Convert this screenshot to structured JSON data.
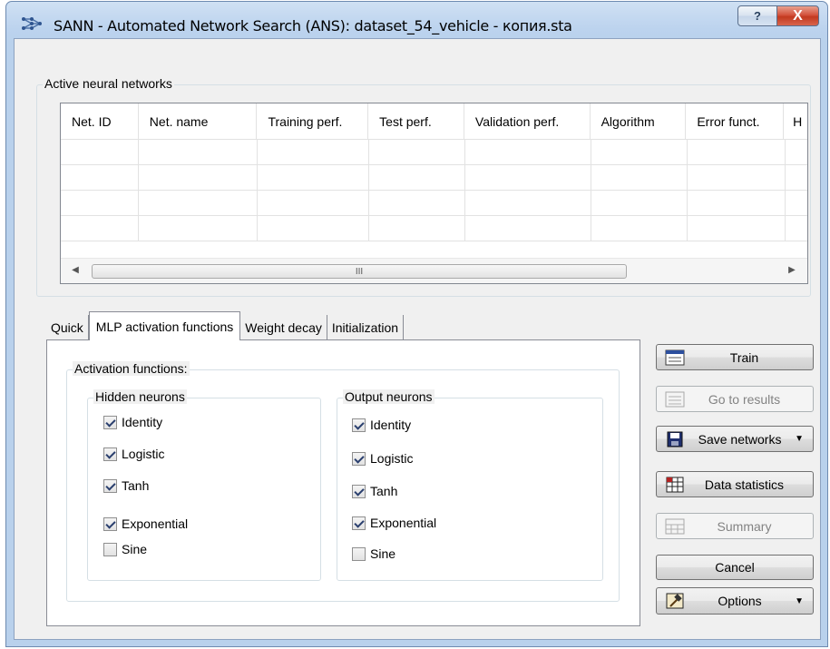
{
  "window": {
    "title": "SANN - Automated Network Search (ANS): dataset_54_vehicle - копия.sta",
    "help_label": "?",
    "close_label": "X"
  },
  "networks_group": {
    "title": "Active neural networks",
    "columns": [
      "Net. ID",
      "Net. name",
      "Training perf.",
      "Test perf.",
      "Validation perf.",
      "Algorithm",
      "Error funct.",
      "H"
    ],
    "scroll_thumb_label": "III"
  },
  "tabs": [
    {
      "label": "Quick",
      "active": false
    },
    {
      "label": "MLP activation functions",
      "active": true
    },
    {
      "label": "Weight decay",
      "active": false
    },
    {
      "label": "Initialization",
      "active": false
    }
  ],
  "activation": {
    "group_title": "Activation functions:",
    "hidden": {
      "title": "Hidden neurons",
      "items": [
        {
          "label": "Identity",
          "checked": true
        },
        {
          "label": "Logistic",
          "checked": true
        },
        {
          "label": "Tanh",
          "checked": true
        },
        {
          "label": "Exponential",
          "checked": true
        },
        {
          "label": "Sine",
          "checked": false
        }
      ]
    },
    "output": {
      "title": "Output neurons",
      "items": [
        {
          "label": "Identity",
          "checked": true
        },
        {
          "label": "Logistic",
          "checked": true
        },
        {
          "label": "Tanh",
          "checked": true
        },
        {
          "label": "Exponential",
          "checked": true
        },
        {
          "label": "Sine",
          "checked": false
        }
      ]
    }
  },
  "buttons": {
    "train": "Train",
    "go_to_results": "Go to results",
    "save_networks": "Save networks",
    "data_statistics": "Data statistics",
    "summary": "Summary",
    "cancel": "Cancel",
    "options": "Options"
  },
  "icons": {
    "app": "network-icon",
    "train": "grid-icon",
    "go_to_results": "grid-icon",
    "save_networks": "floppy-disk-icon",
    "data_statistics": "table-icon",
    "summary": "summary-grid-icon",
    "options": "hammer-icon"
  }
}
